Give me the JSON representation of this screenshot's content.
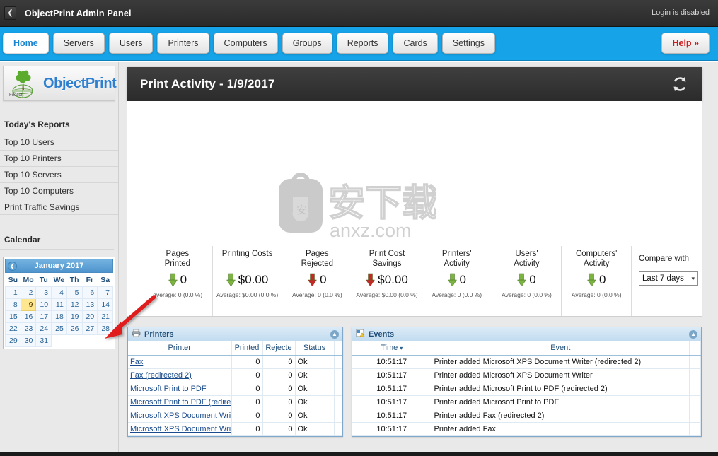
{
  "titlebar": {
    "back_icon": "chevron-left-icon",
    "app_title": "ObjectPrint Admin Panel",
    "login_status": "Login is disabled"
  },
  "nav": {
    "tabs": [
      {
        "label": "Home",
        "active": true
      },
      {
        "label": "Servers",
        "active": false
      },
      {
        "label": "Users",
        "active": false
      },
      {
        "label": "Printers",
        "active": false
      },
      {
        "label": "Computers",
        "active": false
      },
      {
        "label": "Groups",
        "active": false
      },
      {
        "label": "Reports",
        "active": false
      },
      {
        "label": "Cards",
        "active": false
      },
      {
        "label": "Settings",
        "active": false
      }
    ],
    "help_label": "Help »"
  },
  "sidebar": {
    "logo_text": "ObjectPrint",
    "logo_vendor": "Fitosoft",
    "reports_heading": "Today's Reports",
    "reports": [
      {
        "label": "Top 10 Users"
      },
      {
        "label": "Top 10 Printers"
      },
      {
        "label": "Top 10 Servers"
      },
      {
        "label": "Top 10 Computers"
      },
      {
        "label": "Print Traffic Savings"
      }
    ],
    "calendar_heading": "Calendar",
    "calendar": {
      "month_title": "January 2017",
      "prev_icon": "chevron-left-icon",
      "weekdays": [
        "Su",
        "Mo",
        "Tu",
        "We",
        "Th",
        "Fr",
        "Sa"
      ],
      "weeks": [
        [
          "",
          "1",
          "2",
          "3",
          "4",
          "5",
          "6",
          "7"
        ],
        [
          "",
          "8",
          "9",
          "10",
          "11",
          "12",
          "13",
          "14"
        ],
        [
          "",
          "15",
          "16",
          "17",
          "18",
          "19",
          "20",
          "21"
        ],
        [
          "",
          "22",
          "23",
          "24",
          "25",
          "26",
          "27",
          "28"
        ],
        [
          "",
          "29",
          "30",
          "31",
          "",
          "",
          "",
          ""
        ]
      ],
      "selected_day": "9",
      "selected_color": "#ffe690"
    }
  },
  "main": {
    "panel_title": "Print Activity - 1/9/2017",
    "refresh_icon": "refresh-icon",
    "watermark": {
      "text": "anxz.com",
      "cjk": "安下载"
    },
    "stats": [
      {
        "label_line1": "Pages",
        "label_line2": "Printed",
        "value": "0",
        "average": "Average: 0 (0.0 %)",
        "trend": "down",
        "trend_color": "#7cb342"
      },
      {
        "label_line1": "Printing Costs",
        "label_line2": "",
        "value": "$0.00",
        "average": "Average: $0.00 (0.0 %)",
        "trend": "down",
        "trend_color": "#7cb342"
      },
      {
        "label_line1": "Pages",
        "label_line2": "Rejected",
        "value": "0",
        "average": "Average: 0 (0.0 %)",
        "trend": "down",
        "trend_color": "#c62828"
      },
      {
        "label_line1": "Print Cost",
        "label_line2": "Savings",
        "value": "$0.00",
        "average": "Average: $0.00 (0.0 %)",
        "trend": "down",
        "trend_color": "#c62828"
      },
      {
        "label_line1": "Printers'",
        "label_line2": "Activity",
        "value": "0",
        "average": "Average: 0 (0.0 %)",
        "trend": "down",
        "trend_color": "#7cb342"
      },
      {
        "label_line1": "Users'",
        "label_line2": "Activity",
        "value": "0",
        "average": "Average: 0 (0.0 %)",
        "trend": "down",
        "trend_color": "#7cb342"
      },
      {
        "label_line1": "Computers'",
        "label_line2": "Activity",
        "value": "0",
        "average": "Average: 0 (0.0 %)",
        "trend": "down",
        "trend_color": "#7cb342"
      }
    ],
    "compare": {
      "label": "Compare with",
      "selected": "Last 7 days",
      "caret_icon": "chevron-down-icon"
    }
  },
  "printers_panel": {
    "title": "Printers",
    "title_icon": "printer-icon",
    "collapse_icon": "collapse-icon",
    "columns": [
      "Printer",
      "Printed",
      "Rejecte",
      "Status"
    ],
    "rows": [
      {
        "printer": "Fax",
        "printed": "0",
        "rejected": "0",
        "status": "Ok"
      },
      {
        "printer": "Fax (redirected 2)",
        "printed": "0",
        "rejected": "0",
        "status": "Ok"
      },
      {
        "printer": "Microsoft Print to PDF",
        "printed": "0",
        "rejected": "0",
        "status": "Ok"
      },
      {
        "printer": "Microsoft Print to PDF (redirec",
        "printed": "0",
        "rejected": "0",
        "status": "Ok"
      },
      {
        "printer": "Microsoft XPS Document Write",
        "printed": "0",
        "rejected": "0",
        "status": "Ok"
      },
      {
        "printer": "Microsoft XPS Document Write",
        "printed": "0",
        "rejected": "0",
        "status": "Ok"
      }
    ]
  },
  "events_panel": {
    "title": "Events",
    "title_icon": "event-log-icon",
    "collapse_icon": "collapse-icon",
    "columns": [
      "Time",
      "Event"
    ],
    "sort_icon": "sort-ascending-icon",
    "rows": [
      {
        "time": "10:51:17",
        "event": "Printer added Microsoft XPS Document Writer (redirected 2)"
      },
      {
        "time": "10:51:17",
        "event": "Printer added Microsoft XPS Document Writer"
      },
      {
        "time": "10:51:17",
        "event": "Printer added Microsoft Print to PDF (redirected 2)"
      },
      {
        "time": "10:51:17",
        "event": "Printer added Microsoft Print to PDF"
      },
      {
        "time": "10:51:17",
        "event": "Printer added Fax (redirected 2)"
      },
      {
        "time": "10:51:17",
        "event": "Printer added Fax"
      }
    ]
  },
  "annotation": {
    "arrow_color": "#e01b1b",
    "arrow_icon": "red-arrow-annotation"
  }
}
